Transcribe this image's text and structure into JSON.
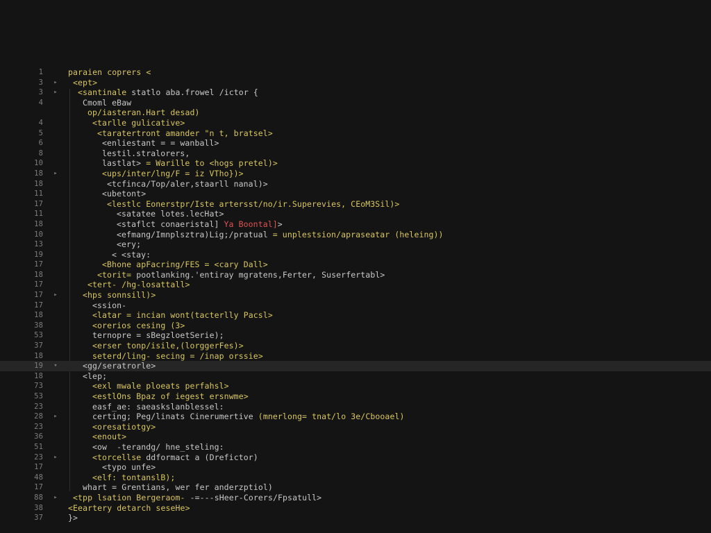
{
  "colors": {
    "background": "#141414",
    "activeLine": "#262626",
    "gutter": "#7d7d7d",
    "tagYellow": "#d9c760",
    "text": "#c9c9c9",
    "red": "#e05252"
  },
  "editor": {
    "lines": [
      {
        "num": "1",
        "fold": "",
        "indent": 0,
        "parts": [
          {
            "t": "paraien coprers <",
            "c": "y"
          }
        ]
      },
      {
        "num": "3",
        "fold": "▸",
        "indent": 1,
        "parts": [
          {
            "t": "<ept>",
            "c": "y"
          }
        ]
      },
      {
        "num": "3",
        "fold": "▸",
        "indent": 2,
        "parts": [
          {
            "t": "<santinale",
            "c": "y"
          },
          {
            "t": " statlo aba.frowel /ictor {",
            "c": "w"
          }
        ]
      },
      {
        "num": "4",
        "fold": "",
        "indent": 3,
        "parts": [
          {
            "t": "Cmoml eBaw",
            "c": "w"
          }
        ]
      },
      {
        "num": "",
        "fold": "",
        "indent": 4,
        "parts": [
          {
            "t": "op/iasteran.Hart desad)",
            "c": "y"
          }
        ]
      },
      {
        "num": "4",
        "fold": "",
        "indent": 5,
        "parts": [
          {
            "t": "<tarlle gulicative>",
            "c": "y"
          }
        ]
      },
      {
        "num": "5",
        "fold": "",
        "indent": 6,
        "parts": [
          {
            "t": "<taratertront",
            "c": "y"
          },
          {
            "t": " amander \"n t, bratsel>",
            "c": "y"
          }
        ]
      },
      {
        "num": "6",
        "fold": "",
        "indent": 7,
        "parts": [
          {
            "t": "<enliestant = = wanball>",
            "c": "w"
          }
        ]
      },
      {
        "num": "8",
        "fold": "",
        "indent": 7,
        "parts": [
          {
            "t": "lestil.stralorers,",
            "c": "w"
          }
        ]
      },
      {
        "num": "10",
        "fold": "",
        "indent": 7,
        "parts": [
          {
            "t": "lastlat>",
            "c": "w"
          },
          {
            "t": " = Warille to <hogs pretel)>",
            "c": "y"
          }
        ]
      },
      {
        "num": "18",
        "fold": "▸",
        "indent": 7,
        "parts": [
          {
            "t": "<ups/inter/lng/F = iz VTho})>",
            "c": "y"
          }
        ]
      },
      {
        "num": "18",
        "fold": "",
        "indent": 8,
        "parts": [
          {
            "t": "<tcfinca/Top/aler,staarll nanal)>",
            "c": "w"
          }
        ]
      },
      {
        "num": "11",
        "fold": "",
        "indent": 7,
        "parts": [
          {
            "t": "<ubetont>",
            "c": "w"
          }
        ]
      },
      {
        "num": "17",
        "fold": "",
        "indent": 8,
        "parts": [
          {
            "t": "<lestlc",
            "c": "y"
          },
          {
            "t": " Eonerstpr/Iste artersst/no/ir.Superevies, CEoM3Sil)>",
            "c": "y"
          }
        ]
      },
      {
        "num": "11",
        "fold": "",
        "indent": 10,
        "parts": [
          {
            "t": "<satatee lotes.lecHat>",
            "c": "w"
          }
        ]
      },
      {
        "num": "18",
        "fold": "",
        "indent": 10,
        "parts": [
          {
            "t": "<staflct conaeristal]",
            "c": "w"
          },
          {
            "t": " Ya Boontal]",
            "c": "r"
          },
          {
            "t": ">",
            "c": "w"
          }
        ]
      },
      {
        "num": "10",
        "fold": "",
        "indent": 10,
        "parts": [
          {
            "t": "<efmang/Imnplsztra)Lig;/pratual",
            "c": "w"
          },
          {
            "t": " = unplestsion/apraseatar (heleing))",
            "c": "y"
          }
        ]
      },
      {
        "num": "13",
        "fold": "",
        "indent": 10,
        "parts": [
          {
            "t": "<ery;",
            "c": "w"
          }
        ]
      },
      {
        "num": "19",
        "fold": "",
        "indent": 9,
        "parts": [
          {
            "t": "< <stay:",
            "c": "w"
          }
        ]
      },
      {
        "num": "17",
        "fold": "",
        "indent": 7,
        "parts": [
          {
            "t": "<Bhone",
            "c": "y"
          },
          {
            "t": " apFacring/FES = <cary Dall>",
            "c": "y"
          }
        ]
      },
      {
        "num": "18",
        "fold": "",
        "indent": 6,
        "parts": [
          {
            "t": "<torit=",
            "c": "y"
          },
          {
            "t": " pootlanking.'entiray mgratens,Ferter, Suserfertabl>",
            "c": "w"
          }
        ]
      },
      {
        "num": "17",
        "fold": "",
        "indent": 4,
        "parts": [
          {
            "t": "<tert",
            "c": "y"
          },
          {
            "t": "- /hg-losattall>",
            "c": "y"
          }
        ]
      },
      {
        "num": "17",
        "fold": "▸",
        "indent": 3,
        "parts": [
          {
            "t": "<hps sonnsill)>",
            "c": "y"
          }
        ]
      },
      {
        "num": "17",
        "fold": "",
        "indent": 5,
        "parts": [
          {
            "t": "<ssion-",
            "c": "w"
          }
        ]
      },
      {
        "num": "18",
        "fold": "",
        "indent": 5,
        "parts": [
          {
            "t": "<latar = incian wont(tacterlly Pacsl>",
            "c": "y"
          }
        ]
      },
      {
        "num": "38",
        "fold": "",
        "indent": 5,
        "parts": [
          {
            "t": "<orerios cesing (3>",
            "c": "y"
          }
        ]
      },
      {
        "num": "53",
        "fold": "",
        "indent": 5,
        "parts": [
          {
            "t": "ternopre = sBegzloetSerie);",
            "c": "w"
          }
        ]
      },
      {
        "num": "37",
        "fold": "",
        "indent": 5,
        "parts": [
          {
            "t": "<erser tonp/isile,(lorggerFes)>",
            "c": "y"
          }
        ]
      },
      {
        "num": "18",
        "fold": "",
        "indent": 5,
        "parts": [
          {
            "t": "seterd/ling-",
            "c": "y"
          },
          {
            "t": " secing = /inap orssie>",
            "c": "y"
          }
        ]
      },
      {
        "num": "19",
        "fold": "▾",
        "indent": 3,
        "active": true,
        "parts": [
          {
            "t": "<gg/seratrorle>",
            "c": "w"
          }
        ]
      },
      {
        "num": "18",
        "fold": "",
        "indent": 3,
        "parts": [
          {
            "t": "<lep;",
            "c": "w"
          }
        ]
      },
      {
        "num": "73",
        "fold": "",
        "indent": 5,
        "parts": [
          {
            "t": "<exl mwale ploeats perfahsl>",
            "c": "y"
          }
        ]
      },
      {
        "num": "53",
        "fold": "",
        "indent": 5,
        "parts": [
          {
            "t": "<estlOns Bpaz of iegest ersnwme>",
            "c": "y"
          }
        ]
      },
      {
        "num": "23",
        "fold": "",
        "indent": 5,
        "parts": [
          {
            "t": "easf_ae: saeaskslanblessel:",
            "c": "w"
          }
        ]
      },
      {
        "num": "28",
        "fold": "▸",
        "indent": 5,
        "parts": [
          {
            "t": "certing; Peg/linats Cinerumertive",
            "c": "w"
          },
          {
            "t": " (mnerlong= tnat/lo 3e/Cbooael)",
            "c": "y"
          }
        ]
      },
      {
        "num": "23",
        "fold": "",
        "indent": 5,
        "parts": [
          {
            "t": "<oresatiotgy>",
            "c": "y"
          }
        ]
      },
      {
        "num": "36",
        "fold": "",
        "indent": 5,
        "parts": [
          {
            "t": "<enout>",
            "c": "y"
          }
        ]
      },
      {
        "num": "51",
        "fold": "",
        "indent": 5,
        "parts": [
          {
            "t": "<ow  -terandg/ hne_steling:",
            "c": "w"
          }
        ]
      },
      {
        "num": "23",
        "fold": "▸",
        "indent": 5,
        "parts": [
          {
            "t": "<torcellse",
            "c": "y"
          },
          {
            "t": " ddformact a (Drefictor)",
            "c": "w"
          }
        ]
      },
      {
        "num": "17",
        "fold": "",
        "indent": 7,
        "parts": [
          {
            "t": "<typo unfe>",
            "c": "w"
          }
        ]
      },
      {
        "num": "48",
        "fold": "",
        "indent": 5,
        "parts": [
          {
            "t": "<elf: tontanslB);",
            "c": "y"
          }
        ]
      },
      {
        "num": "17",
        "fold": "",
        "indent": 3,
        "parts": [
          {
            "t": "whart = Grentians, wer fer anderzptiol)",
            "c": "w"
          }
        ]
      },
      {
        "num": "88",
        "fold": "▸",
        "indent": 1,
        "parts": [
          {
            "t": "<tpp lsation Bergeraom-",
            "c": "y"
          },
          {
            "t": " -=---sHeer-Corers/Fpsatull>",
            "c": "w"
          }
        ]
      },
      {
        "num": "38",
        "fold": "",
        "indent": 0,
        "parts": [
          {
            "t": "<Eeartery detarch seseHe>",
            "c": "y"
          }
        ]
      },
      {
        "num": "37",
        "fold": "",
        "indent": 0,
        "parts": [
          {
            "t": "}>",
            "c": "w"
          }
        ]
      }
    ]
  }
}
